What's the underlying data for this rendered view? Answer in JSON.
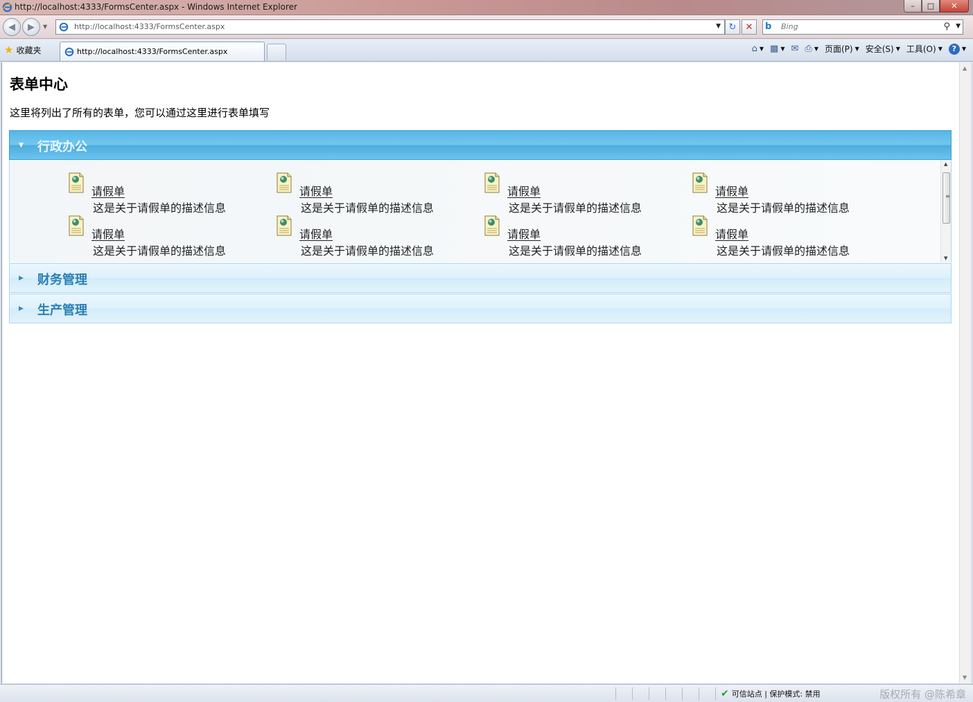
{
  "window": {
    "title": "http://localhost:4333/FormsCenter.aspx - Windows Internet Explorer",
    "controls": [
      "minimize",
      "maximize",
      "close"
    ]
  },
  "toolbar": {
    "address_host": "http://localhost",
    "address_rest": ":4333/FormsCenter.aspx",
    "search_placeholder": "Bing"
  },
  "favbar": {
    "favorites_label": "收藏夹",
    "tab_title": "http://localhost:4333/FormsCenter.aspx",
    "commands": {
      "page": "页面(P)",
      "safety": "安全(S)",
      "tools": "工具(O)",
      "help": "?"
    }
  },
  "page": {
    "title": "表单中心",
    "description": "这里将列出了所有的表单，您可以通过这里进行表单填写"
  },
  "accordion": {
    "sections": [
      {
        "title": "行政办公",
        "expanded": true,
        "forms": [
          {
            "name": "请假单",
            "desc": "这是关于请假单的描述信息"
          },
          {
            "name": "请假单",
            "desc": "这是关于请假单的描述信息"
          },
          {
            "name": "请假单",
            "desc": "这是关于请假单的描述信息"
          },
          {
            "name": "请假单",
            "desc": "这是关于请假单的描述信息"
          },
          {
            "name": "请假单",
            "desc": "这是关于请假单的描述信息"
          },
          {
            "name": "请假单",
            "desc": "这是关于请假单的描述信息"
          },
          {
            "name": "请假单",
            "desc": "这是关于请假单的描述信息"
          },
          {
            "name": "请假单",
            "desc": "这是关于请假单的描述信息"
          }
        ]
      },
      {
        "title": "财务管理",
        "expanded": false
      },
      {
        "title": "生产管理",
        "expanded": false
      }
    ]
  },
  "statusbar": {
    "zone": "可信站点 | 保护模式: 禁用",
    "watermark": "版权所有 @陈希章"
  },
  "colors": {
    "accordion_active": "#56b6e6",
    "accordion_collapsed": "#dff1fb",
    "accordion_title_collapsed": "#2a7fb3"
  }
}
